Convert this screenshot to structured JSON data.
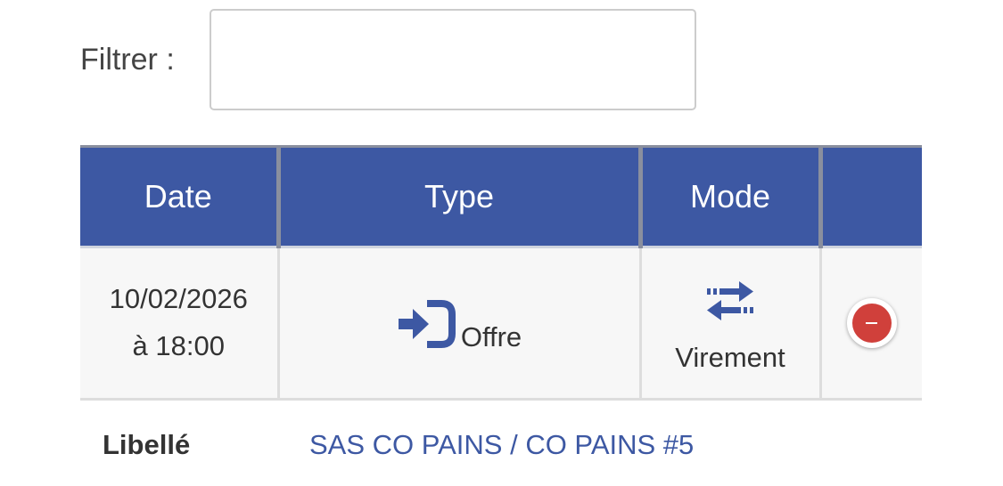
{
  "filter": {
    "label": "Filtrer :",
    "value": "",
    "placeholder": ""
  },
  "table": {
    "columns": [
      "Date",
      "Type",
      "Mode",
      ""
    ],
    "rows": [
      {
        "date": "10/02/2026",
        "time": "à 18:00",
        "type": "Offre",
        "type_icon": "sign-in-icon",
        "mode": "Virement",
        "mode_icon": "transfer-arrows-icon",
        "action_icon": "remove-icon"
      }
    ]
  },
  "libelle": {
    "label": "Libellé",
    "value": "SAS CO PAINS / CO PAINS #5"
  },
  "colors": {
    "header_bg": "#3d58a3",
    "accent": "#3d58a3",
    "remove": "#d0403b",
    "row_bg": "#f7f7f7"
  }
}
